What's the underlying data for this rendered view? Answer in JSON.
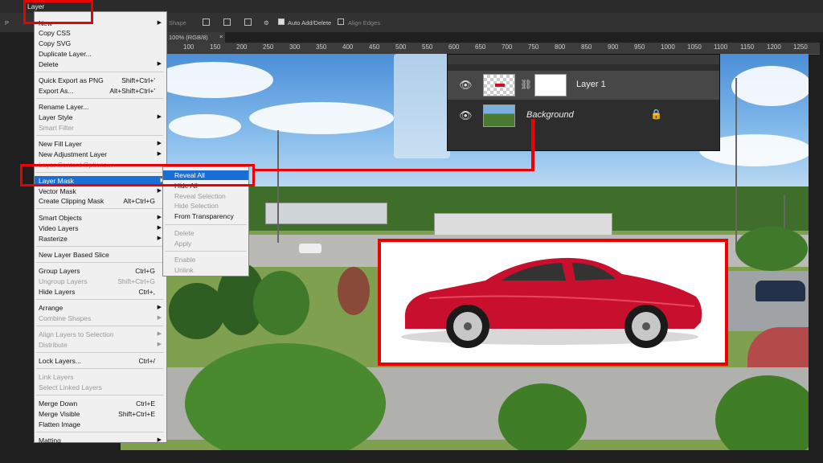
{
  "menubar": {
    "active_menu": "Layer"
  },
  "options_bar": {
    "shape_label": "Shape",
    "auto_add_delete": "Auto Add/Delete",
    "align_edges": "Align Edges"
  },
  "document_tab": {
    "title": "100% (RGB/8)"
  },
  "ruler": {
    "ticks": [
      "100",
      "150",
      "200",
      "250",
      "300",
      "350",
      "400",
      "450",
      "500",
      "550",
      "600",
      "650",
      "700",
      "750",
      "800",
      "850",
      "900",
      "950",
      "1000",
      "1050",
      "1100",
      "1150",
      "1200",
      "1250"
    ]
  },
  "layers_panel": {
    "layers": [
      {
        "name": "Layer 1",
        "selected": true
      },
      {
        "name": "Background",
        "locked": true
      }
    ]
  },
  "layer_menu": {
    "items": {
      "new": "New",
      "copy_css": "Copy CSS",
      "copy_svg": "Copy SVG",
      "duplicate": "Duplicate Layer...",
      "delete": "Delete",
      "quick_export": "Quick Export as PNG",
      "quick_export_sc": "Shift+Ctrl+'",
      "export_as": "Export As...",
      "export_as_sc": "Alt+Shift+Ctrl+'",
      "rename": "Rename Layer...",
      "layer_style": "Layer Style",
      "smart_filter": "Smart Filter",
      "new_fill": "New Fill Layer",
      "new_adjustment": "New Adjustment Layer",
      "layer_content_options": "Layer Content Options...",
      "layer_mask": "Layer Mask",
      "vector_mask": "Vector Mask",
      "clipping_mask": "Create Clipping Mask",
      "clipping_mask_sc": "Alt+Ctrl+G",
      "smart_objects": "Smart Objects",
      "video_layers": "Video Layers",
      "rasterize": "Rasterize",
      "new_slice": "New Layer Based Slice",
      "group_layers": "Group Layers",
      "group_layers_sc": "Ctrl+G",
      "ungroup_layers": "Ungroup Layers",
      "ungroup_layers_sc": "Shift+Ctrl+G",
      "hide_layers": "Hide Layers",
      "hide_layers_sc": "Ctrl+,",
      "arrange": "Arrange",
      "combine_shapes": "Combine Shapes",
      "align_to_selection": "Align Layers to Selection",
      "distribute": "Distribute",
      "lock_layers": "Lock Layers...",
      "lock_layers_sc": "Ctrl+/",
      "link_layers": "Link Layers",
      "select_linked": "Select Linked Layers",
      "merge_down": "Merge Down",
      "merge_down_sc": "Ctrl+E",
      "merge_visible": "Merge Visible",
      "merge_visible_sc": "Shift+Ctrl+E",
      "flatten": "Flatten Image",
      "matting": "Matting"
    }
  },
  "layer_mask_submenu": {
    "reveal_all": "Reveal All",
    "hide_all": "Hide All",
    "reveal_selection": "Reveal Selection",
    "hide_selection": "Hide Selection",
    "from_transparency": "From Transparency",
    "delete": "Delete",
    "apply": "Apply",
    "enable": "Enable",
    "unlink": "Unlink"
  },
  "colors": {
    "annotation": "#e00000",
    "menu_highlight": "#1a6fd6",
    "car": "#c8102e"
  }
}
